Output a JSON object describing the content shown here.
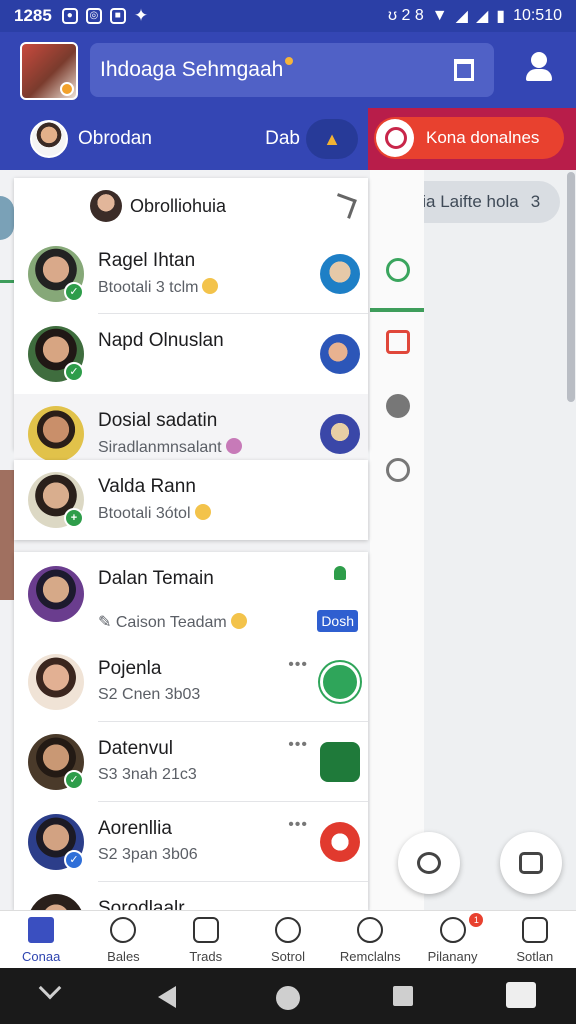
{
  "status_bar": {
    "time": "1285",
    "right_text": "ʊ 2 8",
    "battery_text": "10:510"
  },
  "header": {
    "search_text": "Ihdoaga Sehmgaah"
  },
  "sub_header": {
    "current_chat": "Obrodan",
    "trailing_text": "Dab",
    "action_button_label": "Kona donalnes"
  },
  "right_panel": {
    "chip_label": "Ria Laifte hola",
    "chip_count": "3"
  },
  "card_one": {
    "header_text": "Obrolliohuia",
    "rows": [
      {
        "name": "Ragel Ihtan",
        "subtitle": "Btootali 3 tclm"
      },
      {
        "name": "Napd Olnuslan",
        "subtitle": ""
      },
      {
        "name": "Dosial sadatin",
        "subtitle": "Siradlanmnsalant"
      }
    ]
  },
  "card_two": {
    "rows": [
      {
        "name": "Valda Rann",
        "subtitle": "Btootali 3ótol"
      }
    ]
  },
  "card_three": {
    "rows": [
      {
        "name": "Dalan Temain",
        "subtitle": "Caison Teadam",
        "tag": "Dosh"
      },
      {
        "name": "Pojenla",
        "subtitle": "S2 Cnen 3b03",
        "more": "•••"
      },
      {
        "name": "Datenvul",
        "subtitle": "S3 3nah 21c3",
        "more": "•••"
      },
      {
        "name": "Aorenllia",
        "subtitle": "S2 3pan 3b06",
        "more": "•••"
      },
      {
        "name": "Sorodlaalr",
        "subtitle": ""
      }
    ]
  },
  "bottom_nav": {
    "tabs": [
      {
        "label": "Conaa",
        "icon": "home-icon"
      },
      {
        "label": "Bales",
        "icon": "smile-icon"
      },
      {
        "label": "Trads",
        "icon": "trade-icon"
      },
      {
        "label": "Sotrol",
        "icon": "face-icon"
      },
      {
        "label": "Remclalns",
        "icon": "person-icon"
      },
      {
        "label": "Pilanany",
        "icon": "person-alert-icon",
        "badge": "1"
      },
      {
        "label": "Sotlan",
        "icon": "settings-icon"
      }
    ]
  },
  "colors": {
    "primary": "#3446b4",
    "accent_red": "#e8412f",
    "online_green": "#2e9d4a"
  }
}
